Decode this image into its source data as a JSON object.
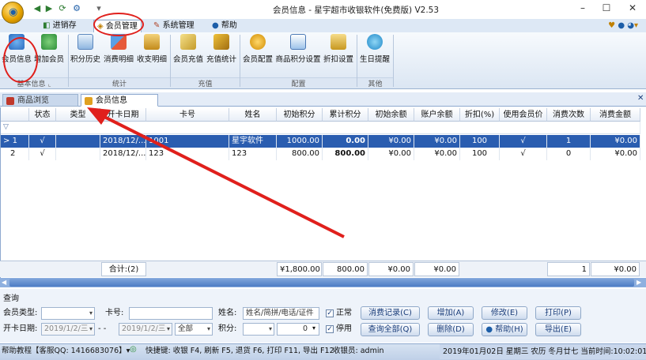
{
  "window": {
    "title": "会员信息 - 星宇超市收银软件(免费版) V2.53",
    "minimize": "–",
    "maximize": "☐",
    "close": "✕"
  },
  "ribbon": {
    "tabs": [
      "进销存",
      "会员管理",
      "系统管理",
      "帮助"
    ],
    "active_tab": "会员管理",
    "buttons": [
      "会员信息",
      "增加会员",
      "积分历史",
      "消费明细",
      "收支明细",
      "会员充值",
      "充值统计",
      "会员配置",
      "商品积分设置",
      "折扣设置",
      "生日提醒"
    ],
    "groups": [
      "基本信息",
      "统计",
      "充值",
      "配置",
      "其他"
    ]
  },
  "doc_tabs": [
    "商品浏览",
    "会员信息"
  ],
  "grid": {
    "columns": [
      "状态",
      "类型",
      "开卡日期",
      "卡号",
      "姓名",
      "初始积分",
      "累计积分",
      "初始余额",
      "账户余额",
      "折扣(%)",
      "使用会员价",
      "消费次数",
      "消费金额"
    ],
    "rows": [
      {
        "num": "1",
        "status": "√",
        "type": "",
        "open_date": "2018/12/...",
        "card": "1001",
        "name": "星宇软件",
        "init_points": "1000.00",
        "total_points": "0.00",
        "init_balance": "¥0.00",
        "balance": "¥0.00",
        "discount": "100",
        "member_price": "√",
        "count": "1",
        "amount": "¥0.00"
      },
      {
        "num": "2",
        "status": "√",
        "type": "",
        "open_date": "2018/12/...",
        "card": "123",
        "name": "123",
        "init_points": "800.00",
        "total_points": "800.00",
        "init_balance": "¥0.00",
        "balance": "¥0.00",
        "discount": "100",
        "member_price": "√",
        "count": "0",
        "amount": "¥0.00"
      }
    ],
    "footer": {
      "count": "合计:(2)",
      "init_points": "¥1,800.00",
      "total_points": "800.00",
      "init_balance": "¥0.00",
      "balance": "¥0.00",
      "count_total": "1",
      "amount": "¥0.00"
    }
  },
  "query": {
    "title": "查询",
    "member_type_label": "会员类型:",
    "card_label": "卡号:",
    "name_label": "姓名:",
    "name_placeholder": "姓名/简拼/电话/证件",
    "open_date_label": "开卡日期:",
    "date_from": "2019/1/2/三",
    "date_sep": "- -",
    "date_to": "2019/1/2/三",
    "range": "全部",
    "points_label": "积分:",
    "points_value": "0",
    "normal": "正常",
    "disabled": "停用",
    "buttons": [
      "消费记录(C)",
      "增加(A)",
      "修改(E)",
      "打印(P)",
      "查询全部(Q)",
      "删除(D)",
      "帮助(H)",
      "导出(E)"
    ]
  },
  "status": {
    "left": "帮助教程【客服QQ: 1416683076】▾",
    "shortcuts": "快捷键: 收银 F4, 刷新 F5, 退货 F6, 打印 F11, 导出 F12",
    "cashier": "收银员: admin",
    "datetime": "2019年01月02日 星期三 农历 冬月廿七 当前时间:10:02:01"
  },
  "colors": {
    "selected_row": "#2a5db0",
    "annotation": "#e0201c",
    "accent": "#1a3d7a"
  }
}
